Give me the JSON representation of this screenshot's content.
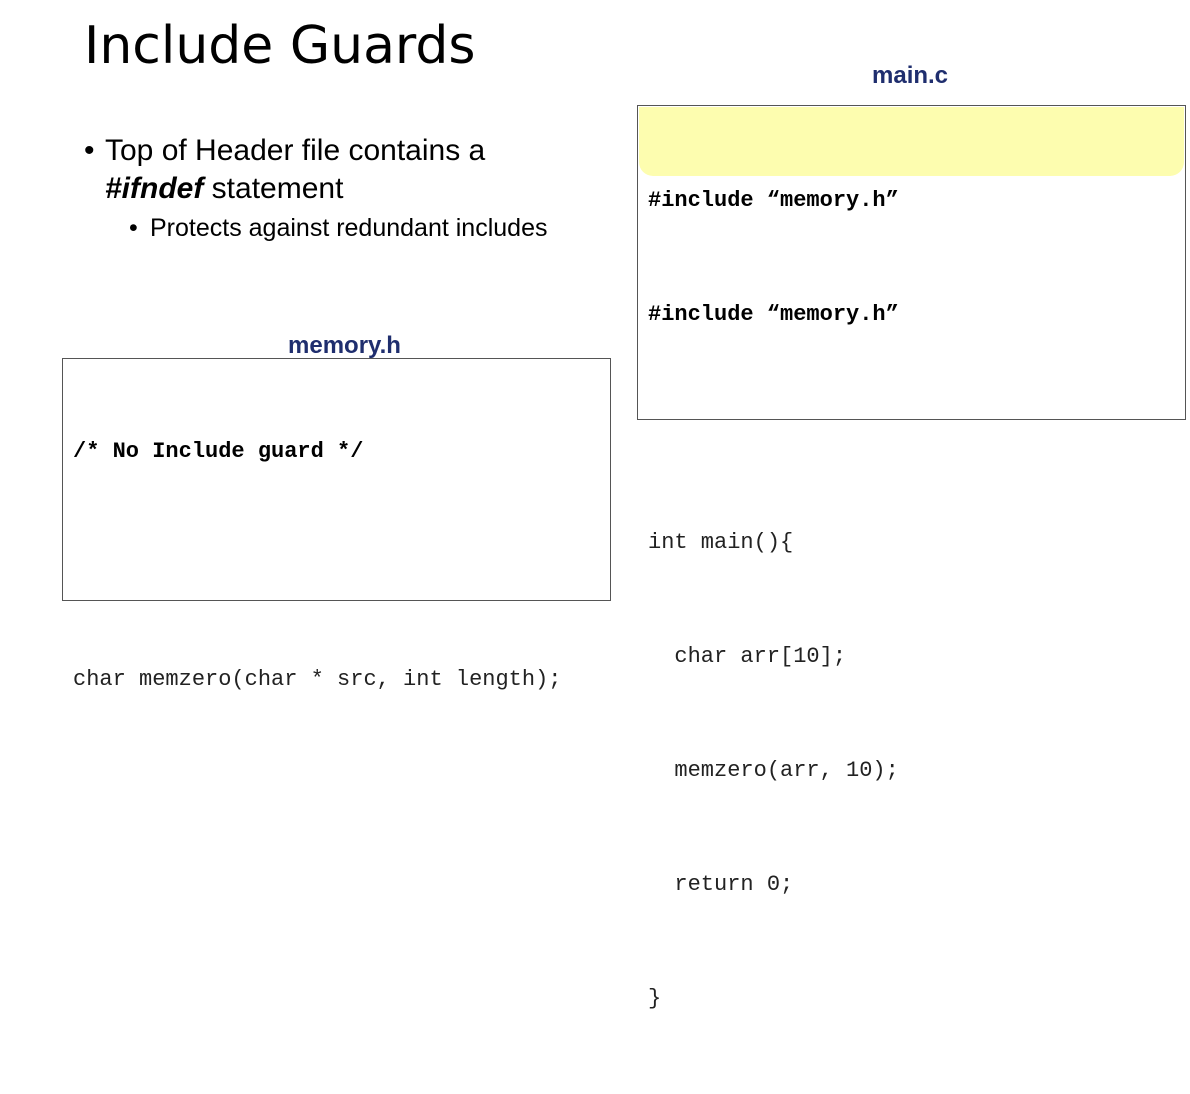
{
  "slide": {
    "title": "Include Guards",
    "bullet_1_prefix": "Top of Header file contains a",
    "bullet_1_keyword": "#ifndef",
    "bullet_1_suffix": " statement",
    "bullet_2": "Protects against redundant includes"
  },
  "main_file": {
    "label": "main.c",
    "highlight_color": "#fdfdaf",
    "lines": [
      "#include “memory.h”",
      "#include “memory.h”",
      "",
      "int main(){",
      "  char arr[10];",
      "  memzero(arr, 10);",
      "  return 0;",
      "}"
    ]
  },
  "header_file": {
    "label": "memory.h",
    "lines": [
      "/* No Include guard */",
      "",
      "char memzero(char * src, int length);"
    ]
  },
  "colors": {
    "label_text": "#1f2e6e"
  }
}
